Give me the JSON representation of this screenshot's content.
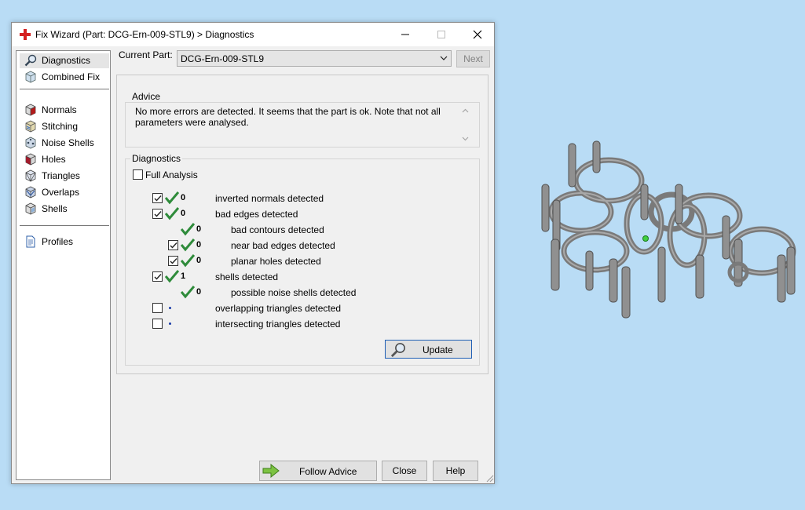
{
  "window": {
    "title": "Fix Wizard (Part: DCG-Ern-009-STL9) > Diagnostics"
  },
  "sidebar": {
    "items": [
      {
        "label": "Diagnostics",
        "icon": "magnifier-icon",
        "selected": true
      },
      {
        "label": "Combined Fix",
        "icon": "cube-icon"
      },
      {
        "label": "Normals",
        "icon": "normals-cube-icon"
      },
      {
        "label": "Stitching",
        "icon": "stitching-cube-icon"
      },
      {
        "label": "Noise Shells",
        "icon": "noise-shells-cube-icon"
      },
      {
        "label": "Holes",
        "icon": "holes-cube-icon"
      },
      {
        "label": "Triangles",
        "icon": "triangles-cube-icon"
      },
      {
        "label": "Overlaps",
        "icon": "overlaps-cube-icon"
      },
      {
        "label": "Shells",
        "icon": "shells-cube-icon"
      },
      {
        "label": "Profiles",
        "icon": "document-icon"
      }
    ]
  },
  "current_part": {
    "label": "Current Part:",
    "value": "DCG-Ern-009-STL9",
    "next_label": "Next"
  },
  "advice": {
    "title": "Advice",
    "text": "No more errors are detected. It seems that the part is ok. Note that not all parameters were analysed."
  },
  "diagnostics": {
    "title": "Diagnostics",
    "full_analysis_label": "Full Analysis",
    "full_analysis_checked": false,
    "rows": [
      {
        "checked": true,
        "status": "ok",
        "count": "0",
        "label": "inverted normals detected"
      },
      {
        "checked": true,
        "status": "ok",
        "count": "0",
        "label": "bad edges detected"
      },
      {
        "checked": null,
        "status": "ok",
        "count": "0",
        "label": "bad contours detected"
      },
      {
        "checked": true,
        "status": "ok",
        "count": "0",
        "label": "near bad edges detected"
      },
      {
        "checked": true,
        "status": "ok",
        "count": "0",
        "label": "planar holes detected"
      },
      {
        "checked": true,
        "status": "ok",
        "count": "1",
        "label": "shells detected"
      },
      {
        "checked": null,
        "status": "ok",
        "count": "0",
        "label": "possible noise shells detected"
      },
      {
        "checked": false,
        "status": "not-analysed",
        "count": "",
        "label": "overlapping triangles detected"
      },
      {
        "checked": false,
        "status": "not-analysed",
        "count": "",
        "label": "intersecting triangles detected"
      }
    ],
    "update_label": "Update"
  },
  "footer": {
    "follow_advice_label": "Follow Advice",
    "close_label": "Close",
    "help_label": "Help"
  },
  "colors": {
    "check_green": "#2e8b3a",
    "desktop_background": "#b9dcf5",
    "model_gray": "#8c8c8c"
  }
}
